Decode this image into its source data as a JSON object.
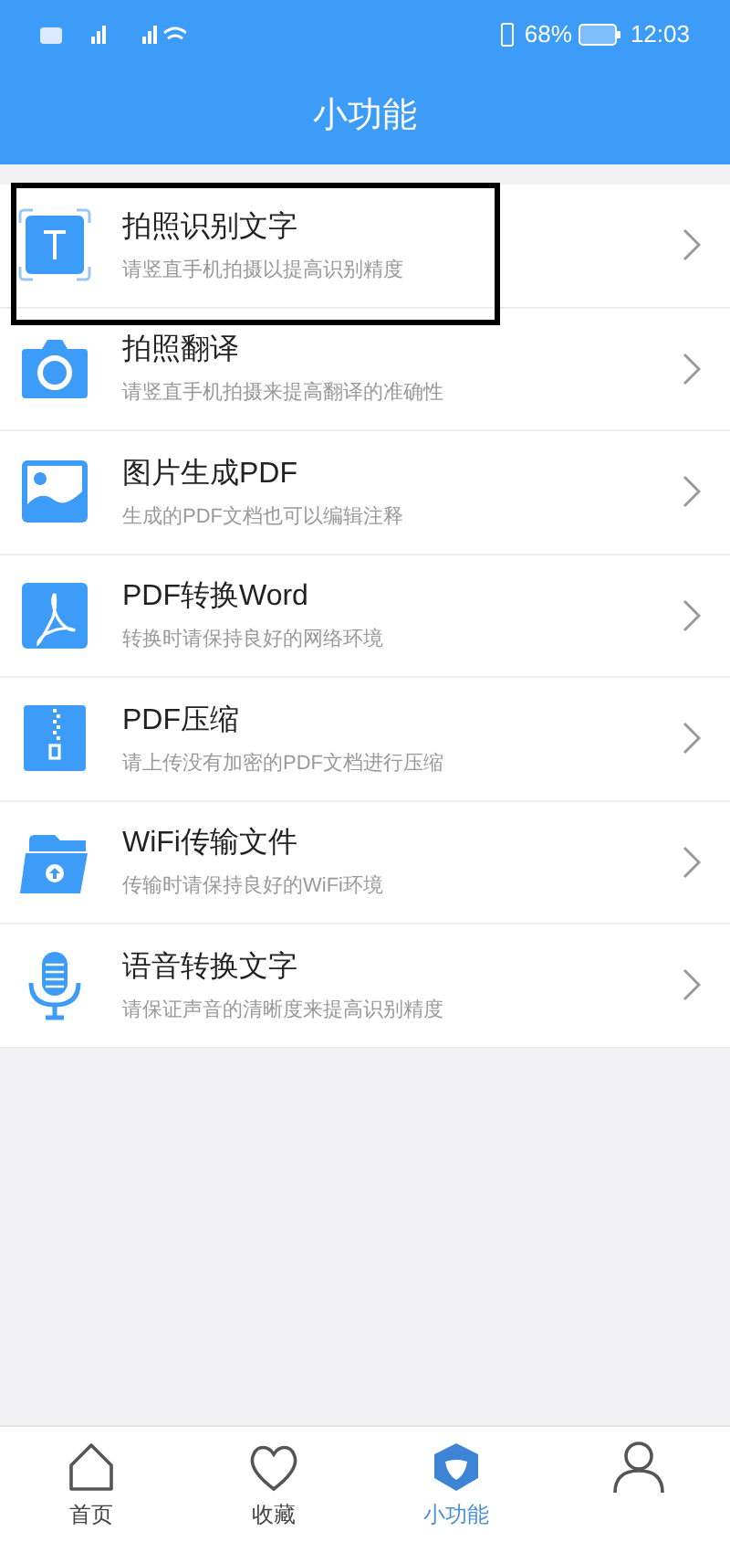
{
  "status_bar": {
    "battery": "68%",
    "time": "12:03"
  },
  "header": {
    "title": "小功能"
  },
  "features": [
    {
      "kind": "text-scan",
      "title": "拍照识别文字",
      "subtitle": "请竖直手机拍摄以提高识别精度",
      "highlighted": true
    },
    {
      "kind": "camera",
      "title": "拍照翻译",
      "subtitle": "请竖直手机拍摄来提高翻译的准确性",
      "highlighted": false
    },
    {
      "kind": "image",
      "title": "图片生成PDF",
      "subtitle": "生成的PDF文档也可以编辑注释",
      "highlighted": false
    },
    {
      "kind": "pdf",
      "title": "PDF转换Word",
      "subtitle": "转换时请保持良好的网络环境",
      "highlighted": false
    },
    {
      "kind": "zip",
      "title": "PDF压缩",
      "subtitle": "请上传没有加密的PDF文档进行压缩",
      "highlighted": false
    },
    {
      "kind": "folder",
      "title": "WiFi传输文件",
      "subtitle": "传输时请保持良好的WiFi环境",
      "highlighted": false
    },
    {
      "kind": "mic",
      "title": "语音转换文字",
      "subtitle": "请保证声音的清晰度来提高识别精度",
      "highlighted": false
    }
  ],
  "tab_bar": [
    {
      "kind": "home",
      "label": "首页",
      "selected": false
    },
    {
      "kind": "heart",
      "label": "收藏",
      "selected": false
    },
    {
      "kind": "shield",
      "label": "小功能",
      "selected": true
    },
    {
      "kind": "person",
      "selected": false
    }
  ]
}
